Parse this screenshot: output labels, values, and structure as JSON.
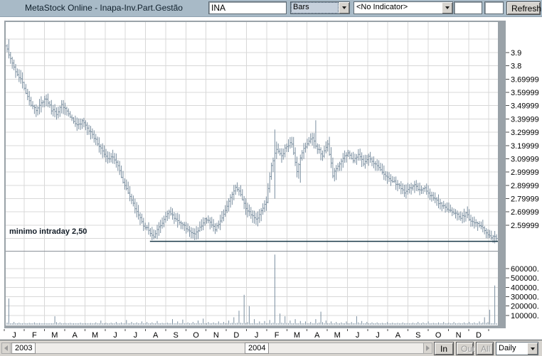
{
  "toolbar": {
    "title": "MetaStock Online - Inapa-Inv.Part.Gestão",
    "symbol_value": "INA",
    "chart_type_value": "Bars",
    "indicator_value": "<No Indicator>",
    "param1": "",
    "param2": "",
    "refresh_label": "Refresh"
  },
  "bottom_bar": {
    "year_left": "2003",
    "year_right": "2004",
    "in_label": "In",
    "out_label": "Out",
    "all_label": "All",
    "period_value": "Daily"
  },
  "colors": {
    "bar": "#7b8fa0",
    "grid": "#d8d8d8",
    "trendline": "#1b3a49",
    "frame": "#9aa2a8",
    "separator": "#8a9097",
    "tick": "#4a4a4a",
    "text": "#000000"
  },
  "chart_data": {
    "type": "bar",
    "bar_style": "OHLC daily bars with volume sub-panel",
    "symbol": "INA",
    "annotation": "minimo intraday 2,50",
    "trendline": {
      "price": 2.5,
      "x_start_frac": 0.293
    },
    "price_axis_labels": [
      "3.9",
      "3.8",
      "3.69999",
      "3.59999",
      "3.49999",
      "3.39999",
      "3.29999",
      "3.19999",
      "3.09999",
      "2.99999",
      "2.89999",
      "2.79999",
      "2.69999",
      "2.59999"
    ],
    "volume_axis_labels": [
      "600000.",
      "500000.",
      "400000.",
      "300000.",
      "200000.",
      "100000."
    ],
    "price_ylim": [
      2.45,
      4.05
    ],
    "volume_ylim": [
      0,
      780000
    ],
    "x_months": [
      "J",
      "F",
      "M",
      "A",
      "M",
      "J",
      "J",
      "A",
      "S",
      "O",
      "N",
      "D",
      "J",
      "F",
      "M",
      "A",
      "M",
      "J",
      "J",
      "A",
      "S",
      "O",
      "N",
      "D"
    ],
    "x_years": [
      "2003",
      "2004"
    ],
    "weekly_close": [
      3.95,
      3.85,
      3.76,
      3.7,
      3.6,
      3.51,
      3.46,
      3.52,
      3.55,
      3.47,
      3.44,
      3.5,
      3.46,
      3.4,
      3.35,
      3.38,
      3.33,
      3.28,
      3.22,
      3.15,
      3.1,
      3.12,
      3.04,
      2.93,
      2.85,
      2.76,
      2.68,
      2.6,
      2.56,
      2.52,
      2.58,
      2.64,
      2.7,
      2.66,
      2.62,
      2.59,
      2.55,
      2.53,
      2.58,
      2.64,
      2.62,
      2.57,
      2.63,
      2.72,
      2.8,
      2.88,
      2.84,
      2.72,
      2.68,
      2.64,
      2.7,
      2.78,
      3.05,
      3.18,
      3.12,
      3.2,
      3.22,
      3.0,
      3.15,
      3.22,
      3.25,
      3.18,
      3.12,
      3.22,
      2.98,
      3.04,
      3.1,
      3.15,
      3.09,
      3.13,
      3.07,
      3.11,
      3.07,
      3.04,
      2.99,
      2.95,
      2.93,
      2.89,
      2.85,
      2.88,
      2.9,
      2.86,
      2.88,
      2.83,
      2.79,
      2.76,
      2.73,
      2.71,
      2.69,
      2.65,
      2.69,
      2.63,
      2.61,
      2.59,
      2.55,
      2.51
    ],
    "weekly_volume_peak": [
      280000,
      30000,
      22000,
      18000,
      20000,
      25000,
      18000,
      15000,
      15000,
      90000,
      25000,
      18000,
      20000,
      15000,
      22000,
      16000,
      18000,
      25000,
      45000,
      20000,
      22000,
      30000,
      25000,
      50000,
      30000,
      25000,
      35000,
      28000,
      25000,
      40000,
      20000,
      22000,
      60000,
      35000,
      55000,
      25000,
      30000,
      45000,
      65000,
      28000,
      25000,
      35000,
      30000,
      45000,
      80000,
      150000,
      320000,
      200000,
      60000,
      35000,
      40000,
      50000,
      750000,
      120000,
      90000,
      45000,
      60000,
      40000,
      35000,
      30000,
      60000,
      140000,
      45000,
      35000,
      30000,
      25000,
      35000,
      28000,
      90000,
      40000,
      30000,
      25000,
      25000,
      20000,
      28000,
      22000,
      20000,
      25000,
      18000,
      22000,
      30000,
      25000,
      35000,
      20000,
      25000,
      30000,
      22000,
      28000,
      20000,
      25000,
      30000,
      24000,
      35000,
      80000,
      160000,
      420000
    ],
    "extremes": {
      "0": {
        "hi": 4.0
      },
      "29": {
        "lo": 2.5
      },
      "37": {
        "lo": 2.51
      },
      "52": {
        "hi": 3.32,
        "lo": 2.8
      },
      "57": {
        "lo": 2.92
      },
      "60": {
        "hi": 3.39
      },
      "64": {
        "lo": 2.94
      },
      "95": {
        "lo": 2.5
      }
    }
  }
}
